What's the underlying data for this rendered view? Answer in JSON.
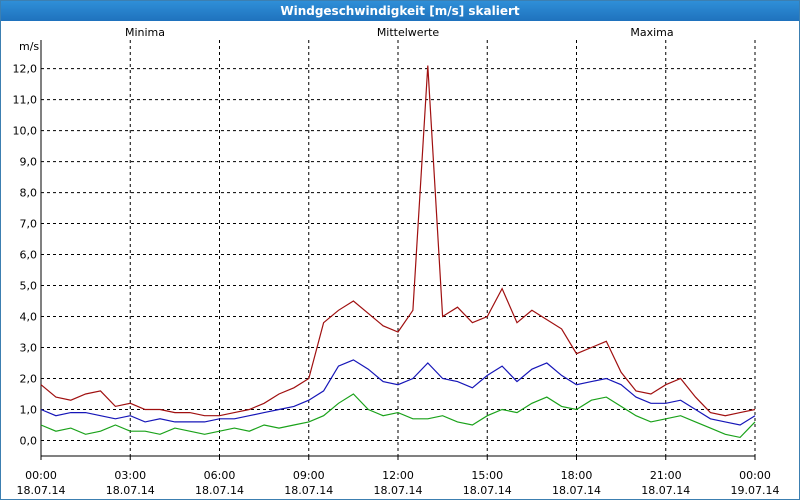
{
  "window": {
    "title": "Windgeschwindigkeit [m/s] skaliert"
  },
  "chart_data": {
    "type": "line",
    "title": "Windgeschwindigkeit [m/s] skaliert",
    "ylabel": "m/s",
    "xlabel": "",
    "ylim": [
      -0.5,
      12.6
    ],
    "yticks": [
      "0,0",
      "1,0",
      "2,0",
      "3,0",
      "4,0",
      "5,0",
      "6,0",
      "7,0",
      "8,0",
      "9,0",
      "10,0",
      "11,0",
      "12,0"
    ],
    "xticks": [
      {
        "time": "00:00",
        "date": "18.07.14"
      },
      {
        "time": "03:00",
        "date": "18.07.14"
      },
      {
        "time": "06:00",
        "date": "18.07.14"
      },
      {
        "time": "09:00",
        "date": "18.07.14"
      },
      {
        "time": "12:00",
        "date": "18.07.14"
      },
      {
        "time": "15:00",
        "date": "18.07.14"
      },
      {
        "time": "18:00",
        "date": "18.07.14"
      },
      {
        "time": "21:00",
        "date": "18.07.14"
      },
      {
        "time": "00:00",
        "date": "19.07.14"
      }
    ],
    "xlim_hours": [
      0,
      24
    ],
    "grid": true,
    "legend_placement": "top",
    "x_hours": [
      0,
      0.5,
      1,
      1.5,
      2,
      2.5,
      3,
      3.5,
      4,
      4.5,
      5,
      5.5,
      6,
      6.5,
      7,
      7.5,
      8,
      8.5,
      9,
      9.5,
      10,
      10.5,
      11,
      11.5,
      12,
      12.5,
      13,
      13.5,
      14,
      14.5,
      15,
      15.5,
      16,
      16.5,
      17,
      17.5,
      18,
      18.5,
      19,
      19.5,
      20,
      20.5,
      21,
      21.5,
      22,
      22.5,
      23,
      23.5,
      24
    ],
    "series": [
      {
        "name": "Minima",
        "color": "#1aa21a",
        "values": [
          0.5,
          0.3,
          0.4,
          0.2,
          0.3,
          0.5,
          0.3,
          0.3,
          0.2,
          0.4,
          0.3,
          0.2,
          0.3,
          0.4,
          0.3,
          0.5,
          0.4,
          0.5,
          0.6,
          0.8,
          1.2,
          1.5,
          1.0,
          0.8,
          0.9,
          0.7,
          0.7,
          0.8,
          0.6,
          0.5,
          0.8,
          1.0,
          0.9,
          1.2,
          1.4,
          1.1,
          1.0,
          1.3,
          1.4,
          1.1,
          0.8,
          0.6,
          0.7,
          0.8,
          0.6,
          0.4,
          0.2,
          0.1,
          0.6
        ]
      },
      {
        "name": "Mittelwerte",
        "color": "#1616b8",
        "values": [
          1.0,
          0.8,
          0.9,
          0.9,
          0.8,
          0.7,
          0.8,
          0.6,
          0.7,
          0.6,
          0.6,
          0.6,
          0.7,
          0.7,
          0.8,
          0.9,
          1.0,
          1.1,
          1.3,
          1.6,
          2.4,
          2.6,
          2.3,
          1.9,
          1.8,
          2.0,
          2.5,
          2.0,
          1.9,
          1.7,
          2.1,
          2.4,
          1.9,
          2.3,
          2.5,
          2.1,
          1.8,
          1.9,
          2.0,
          1.8,
          1.4,
          1.2,
          1.2,
          1.3,
          1.0,
          0.7,
          0.6,
          0.5,
          0.8
        ]
      },
      {
        "name": "Maxima",
        "color": "#a01010",
        "values": [
          1.8,
          1.4,
          1.3,
          1.5,
          1.6,
          1.1,
          1.2,
          1.0,
          1.0,
          0.9,
          0.9,
          0.8,
          0.8,
          0.9,
          1.0,
          1.2,
          1.5,
          1.7,
          2.0,
          3.8,
          4.2,
          4.5,
          4.1,
          3.7,
          3.5,
          4.2,
          12.1,
          4.0,
          4.3,
          3.8,
          4.0,
          4.9,
          3.8,
          4.2,
          3.9,
          3.6,
          2.8,
          3.0,
          3.2,
          2.2,
          1.6,
          1.5,
          1.8,
          2.0,
          1.4,
          0.9,
          0.8,
          0.9,
          1.0
        ]
      }
    ]
  }
}
